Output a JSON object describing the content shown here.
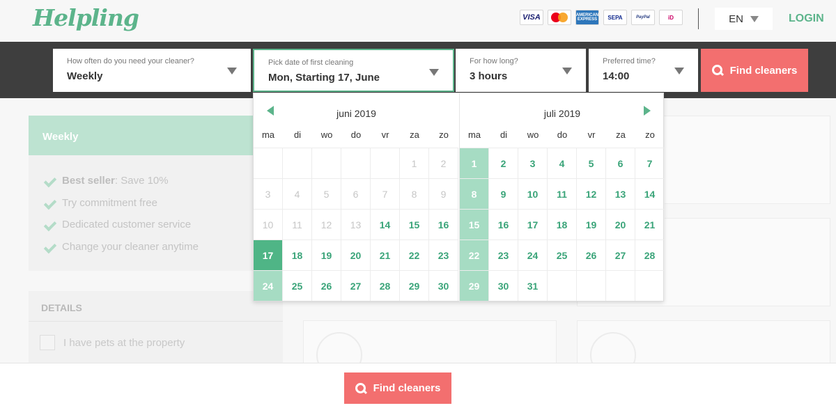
{
  "header": {
    "logo": "Helpling",
    "payments": [
      {
        "name": "visa-logo",
        "label": "VISA"
      },
      {
        "name": "mastercard-logo",
        "label": ""
      },
      {
        "name": "amex-logo",
        "label": "AMERICAN EXPRESS"
      },
      {
        "name": "sepa-logo",
        "label": "SEPA"
      },
      {
        "name": "paypal-logo",
        "label": "PayPal"
      },
      {
        "name": "ideal-logo",
        "label": "iD"
      }
    ],
    "language": "EN",
    "login": "LOGIN"
  },
  "search": {
    "frequency": {
      "label": "How often do you need your cleaner?",
      "value": "Weekly"
    },
    "date": {
      "label": "Pick date of first cleaning",
      "value": "Mon, Starting 17, June"
    },
    "duration": {
      "label": "For how long?",
      "value": "3 hours"
    },
    "time": {
      "label": "Preferred time?",
      "value": "14:00"
    },
    "button": "Find cleaners"
  },
  "colors": {
    "brand": "#5cb48b",
    "cta": "#f36f6f",
    "selected": "#4fb586",
    "recurring": "#a6dcc3"
  },
  "calendar": {
    "weekdays": [
      "ma",
      "di",
      "wo",
      "do",
      "vr",
      "za",
      "zo"
    ],
    "months": [
      {
        "title": "juni 2019",
        "weeks": [
          [
            null,
            null,
            null,
            null,
            null,
            {
              "d": "1",
              "s": "dis"
            },
            {
              "d": "2",
              "s": "dis"
            }
          ],
          [
            {
              "d": "3",
              "s": "dis"
            },
            {
              "d": "4",
              "s": "dis"
            },
            {
              "d": "5",
              "s": "dis"
            },
            {
              "d": "6",
              "s": "dis"
            },
            {
              "d": "7",
              "s": "dis"
            },
            {
              "d": "8",
              "s": "dis"
            },
            {
              "d": "9",
              "s": "dis"
            }
          ],
          [
            {
              "d": "10",
              "s": "dis"
            },
            {
              "d": "11",
              "s": "dis"
            },
            {
              "d": "12",
              "s": "dis"
            },
            {
              "d": "13",
              "s": "dis"
            },
            {
              "d": "14",
              "s": "en"
            },
            {
              "d": "15",
              "s": "en"
            },
            {
              "d": "16",
              "s": "en"
            }
          ],
          [
            {
              "d": "17",
              "s": "sel"
            },
            {
              "d": "18",
              "s": "en"
            },
            {
              "d": "19",
              "s": "en"
            },
            {
              "d": "20",
              "s": "en"
            },
            {
              "d": "21",
              "s": "en"
            },
            {
              "d": "22",
              "s": "en"
            },
            {
              "d": "23",
              "s": "en"
            }
          ],
          [
            {
              "d": "24",
              "s": "wk"
            },
            {
              "d": "25",
              "s": "en"
            },
            {
              "d": "26",
              "s": "en"
            },
            {
              "d": "27",
              "s": "en"
            },
            {
              "d": "28",
              "s": "en"
            },
            {
              "d": "29",
              "s": "en"
            },
            {
              "d": "30",
              "s": "en"
            }
          ]
        ]
      },
      {
        "title": "juli 2019",
        "weeks": [
          [
            {
              "d": "1",
              "s": "wk"
            },
            {
              "d": "2",
              "s": "en"
            },
            {
              "d": "3",
              "s": "en"
            },
            {
              "d": "4",
              "s": "en"
            },
            {
              "d": "5",
              "s": "en"
            },
            {
              "d": "6",
              "s": "en"
            },
            {
              "d": "7",
              "s": "en"
            }
          ],
          [
            {
              "d": "8",
              "s": "wk"
            },
            {
              "d": "9",
              "s": "en"
            },
            {
              "d": "10",
              "s": "en"
            },
            {
              "d": "11",
              "s": "en"
            },
            {
              "d": "12",
              "s": "en"
            },
            {
              "d": "13",
              "s": "en"
            },
            {
              "d": "14",
              "s": "en"
            }
          ],
          [
            {
              "d": "15",
              "s": "wk"
            },
            {
              "d": "16",
              "s": "en"
            },
            {
              "d": "17",
              "s": "en"
            },
            {
              "d": "18",
              "s": "en"
            },
            {
              "d": "19",
              "s": "en"
            },
            {
              "d": "20",
              "s": "en"
            },
            {
              "d": "21",
              "s": "en"
            }
          ],
          [
            {
              "d": "22",
              "s": "wk"
            },
            {
              "d": "23",
              "s": "en"
            },
            {
              "d": "24",
              "s": "en"
            },
            {
              "d": "25",
              "s": "en"
            },
            {
              "d": "26",
              "s": "en"
            },
            {
              "d": "27",
              "s": "en"
            },
            {
              "d": "28",
              "s": "en"
            }
          ],
          [
            {
              "d": "29",
              "s": "wk"
            },
            {
              "d": "30",
              "s": "en"
            },
            {
              "d": "31",
              "s": "en"
            },
            null,
            null,
            null,
            null
          ]
        ]
      }
    ]
  },
  "sidebar": {
    "plan": "Weekly",
    "features": [
      {
        "bold": "Best seller",
        "text": ": Save 10%"
      },
      {
        "bold": "",
        "text": "Try commitment free"
      },
      {
        "bold": "",
        "text": "Dedicated customer service"
      },
      {
        "bold": "",
        "text": "Change your cleaner anytime"
      }
    ],
    "details_title": "DETAILS",
    "pets_label": "I have pets at the property"
  },
  "footer": {
    "button": "Find cleaners"
  }
}
